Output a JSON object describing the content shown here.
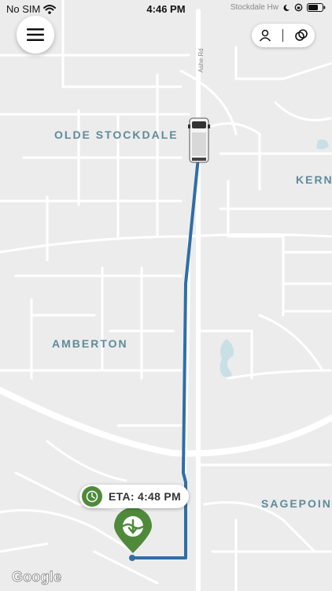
{
  "status_bar": {
    "carrier": "No SIM",
    "time": "4:46 PM",
    "street_hint": "Stockdale Hw"
  },
  "map": {
    "neighborhoods": {
      "olde_stockdale": "OLDE STOCKDALE",
      "kern": "KERN",
      "amberton": "AMBERTON",
      "sagepoint": "SAGEPOIN"
    },
    "roads": {
      "ashe_rd": "Ashe Rd"
    },
    "colors": {
      "route": "#2f6ea6",
      "marker": "#4f8a3b",
      "water": "#c9dfe6"
    }
  },
  "eta": {
    "label": "ETA: 4:48 PM"
  },
  "attribution": "Google",
  "icons": {
    "menu": "hamburger-menu-icon",
    "profile": "person-icon",
    "link": "linked-circles-icon",
    "clock": "clock-icon",
    "destination": "destination-pin-icon",
    "vehicle": "van-icon"
  }
}
